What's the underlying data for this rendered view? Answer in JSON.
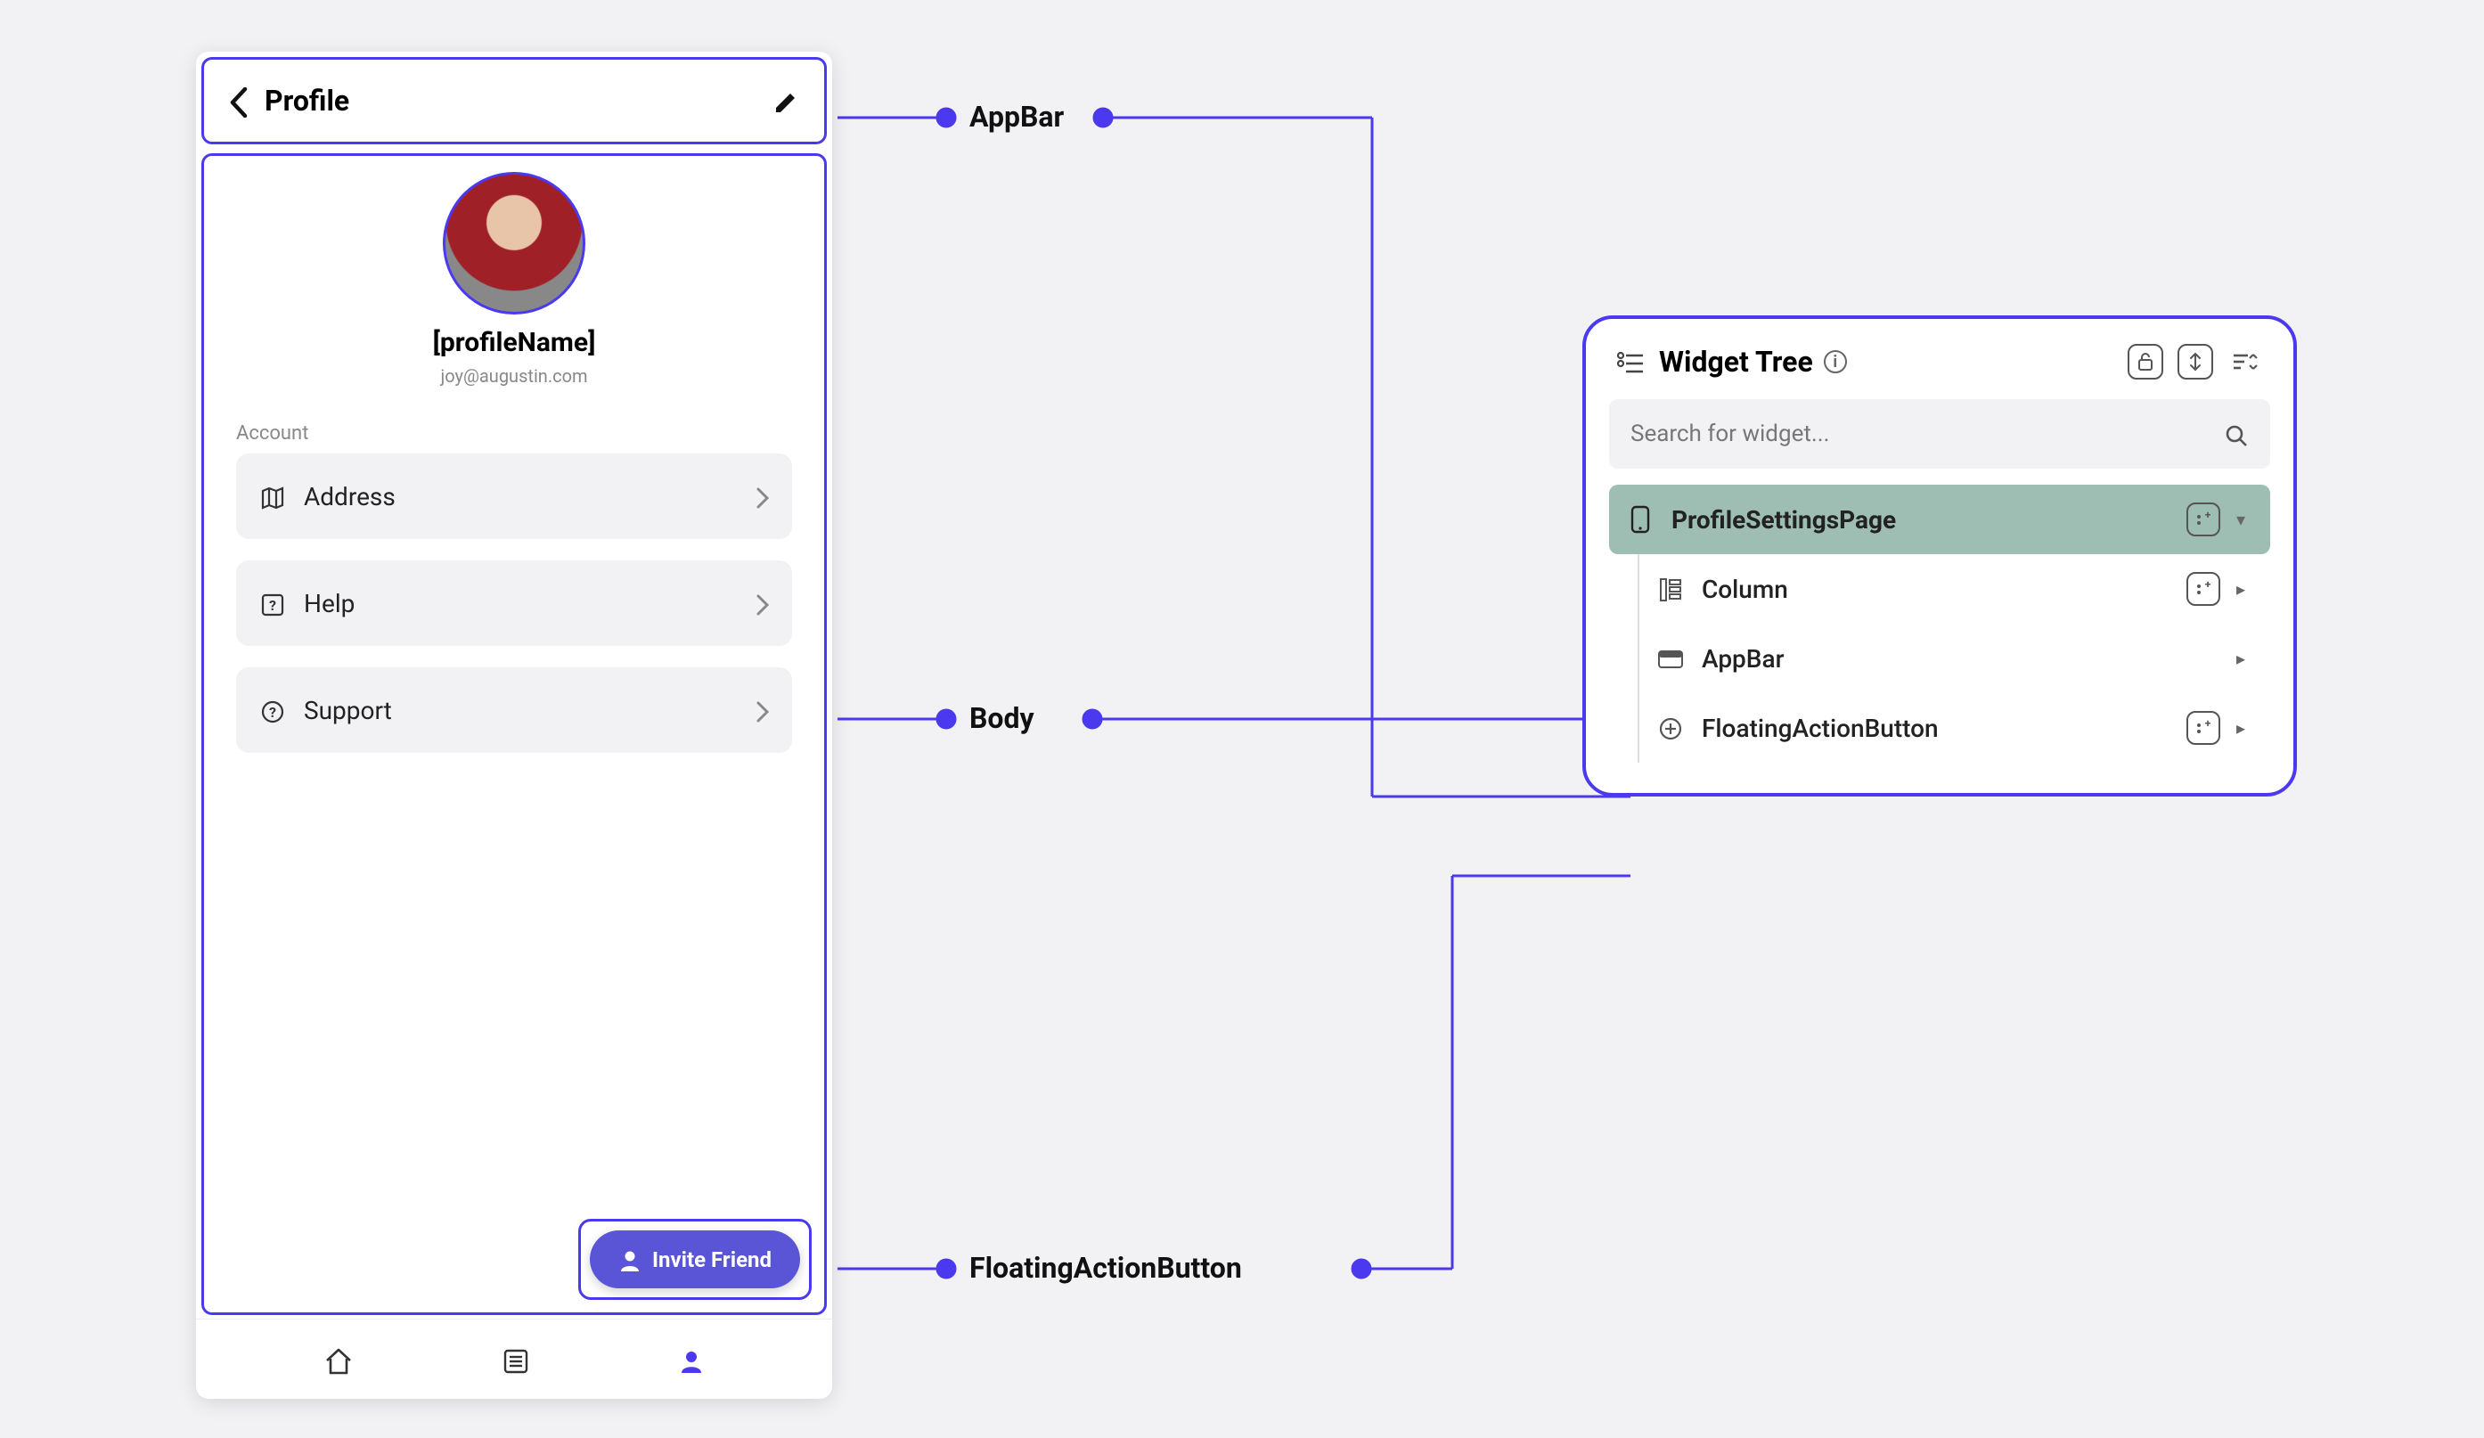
{
  "labels": {
    "appbar": "AppBar",
    "body": "Body",
    "fab": "FloatingActionButton"
  },
  "phone": {
    "appbar": {
      "title": "Profile"
    },
    "profile": {
      "name": "[profileName]",
      "email": "joy@augustin.com"
    },
    "sectionLabel": "Account",
    "rows": [
      {
        "label": "Address",
        "icon": "map-icon"
      },
      {
        "label": "Help",
        "icon": "help-square-icon"
      },
      {
        "label": "Support",
        "icon": "help-circle-icon"
      }
    ],
    "fab": {
      "label": "Invite Friend"
    }
  },
  "panel": {
    "title": "Widget Tree",
    "searchPlaceholder": "Search for widget...",
    "tree": [
      {
        "label": "ProfileSettingsPage",
        "icon": "phone-icon",
        "selected": true,
        "hasAdd": true,
        "collapsed": false
      },
      {
        "label": "Column",
        "icon": "column-icon",
        "hasAdd": true
      },
      {
        "label": "AppBar",
        "icon": "appbar-icon"
      },
      {
        "label": "FloatingActionButton",
        "icon": "plus-circle-icon",
        "hasAdd": true
      }
    ]
  },
  "colors": {
    "primary": "#4b39ef"
  }
}
